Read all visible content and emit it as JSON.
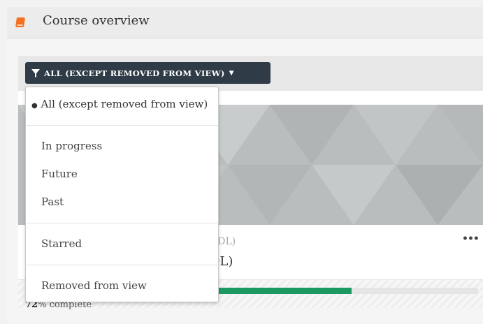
{
  "header": {
    "title": "Course overview",
    "icon": "book-icon"
  },
  "filter": {
    "label": "ALL (EXCEPT REMOVED FROM VIEW)",
    "icon": "filter-icon",
    "caret_icon": "caret-down-icon"
  },
  "dropdown": {
    "selected_marker": "●",
    "items": [
      {
        "label": "All (except removed from view)",
        "selected": true
      },
      {
        "label": "In progress"
      },
      {
        "label": "Future"
      },
      {
        "label": "Past"
      },
      {
        "label": "Starred"
      },
      {
        "label": "Removed from view"
      }
    ]
  },
  "course": {
    "category_partial": "DDL)",
    "title_partial": "DL)",
    "menu_label": "•••",
    "progress_value": "72",
    "progress_fraction": 0.72,
    "progress_suffix": "% complete"
  },
  "colors": {
    "accent": "#2f3b46",
    "progress": "#1a9a62",
    "icon_orange": "#f2701e"
  }
}
